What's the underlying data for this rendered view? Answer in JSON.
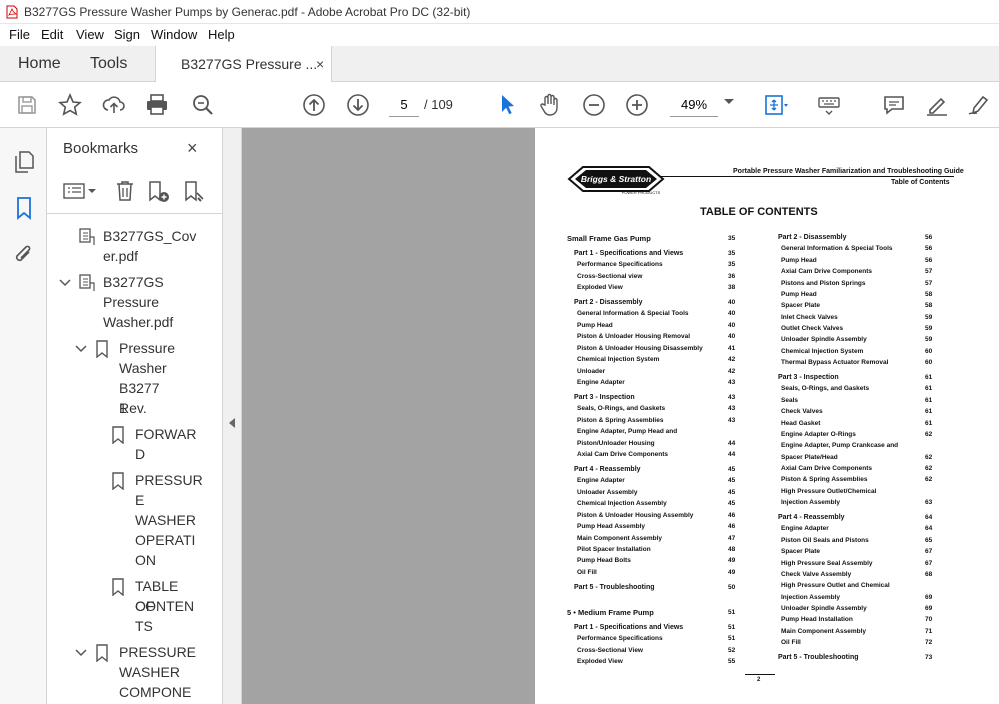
{
  "window": {
    "title": "B3277GS Pressure Washer Pumps by Generac.pdf - Adobe Acrobat Pro DC (32-bit)"
  },
  "menu": [
    "File",
    "Edit",
    "View",
    "Sign",
    "Window",
    "Help"
  ],
  "tabs": {
    "home": "Home",
    "tools": "Tools",
    "doc": "B3277GS Pressure ...",
    "close": "×"
  },
  "toolbar": {
    "page_current": "5",
    "page_total": "/  109",
    "zoom": "49%"
  },
  "bookmarks": {
    "title": "Bookmarks",
    "close": "×",
    "items": [
      {
        "lines": [
          "B3277GS_Cov",
          "er.pdf"
        ]
      },
      {
        "lines": [
          "B3277GS",
          "Pressure",
          "Washer.pdf"
        ]
      },
      {
        "lines": [
          "Pressure",
          "Washer",
          "B3277 Rev.",
          "1"
        ]
      },
      {
        "lines": [
          "FORWAR",
          "D"
        ]
      },
      {
        "lines": [
          "PRESSUR",
          "E",
          "WASHER",
          "OPERATI",
          "ON"
        ]
      },
      {
        "lines": [
          "TABLE OF",
          "CONTEN",
          "TS"
        ]
      },
      {
        "lines": [
          "PRESSURE",
          "WASHER",
          "COMPONE"
        ]
      }
    ]
  },
  "pdf": {
    "logo_text": "Briggs & Stratton",
    "logo_sub": "POWER PRODUCTS",
    "header_right": "Portable Pressure Washer Familiarization and Troubleshooting Guide",
    "header_sub": "Table of Contents",
    "toc_title": "TABLE OF CONTENTS",
    "footer_page": "2",
    "left_col": [
      {
        "t": "Small Frame Gas Pump",
        "p": "35",
        "k": "sec"
      },
      {
        "t": "Part 1 - Specifications and Views",
        "p": "35",
        "k": "part"
      },
      {
        "t": "Performance Specifications",
        "p": "35",
        "k": "item"
      },
      {
        "t": "Cross-Sectional view",
        "p": "36",
        "k": "item"
      },
      {
        "t": "Exploded View",
        "p": "38",
        "k": "item"
      },
      {
        "t": "Part 2 - Disassembly",
        "p": "40",
        "k": "part"
      },
      {
        "t": "General Information & Special Tools",
        "p": "40",
        "k": "item"
      },
      {
        "t": "Pump Head",
        "p": "40",
        "k": "item"
      },
      {
        "t": "Piston & Unloader Housing Removal",
        "p": "40",
        "k": "item"
      },
      {
        "t": "Piston & Unloader Housing Disassembly",
        "p": "41",
        "k": "item"
      },
      {
        "t": "Chemical Injection System",
        "p": "42",
        "k": "item"
      },
      {
        "t": "Unloader",
        "p": "42",
        "k": "item"
      },
      {
        "t": "Engine Adapter",
        "p": "43",
        "k": "item"
      },
      {
        "t": "Part 3 - Inspection",
        "p": "43",
        "k": "part"
      },
      {
        "t": "Seals, O-Rings, and Gaskets",
        "p": "43",
        "k": "item"
      },
      {
        "t": "Piston & Spring Assemblies",
        "p": "43",
        "k": "item"
      },
      {
        "t": "Engine Adapter, Pump Head and",
        "p": "",
        "k": "item"
      },
      {
        "t": "Piston/Unloader Housing",
        "p": "44",
        "k": "item"
      },
      {
        "t": "Axial Cam Drive Components",
        "p": "44",
        "k": "item"
      },
      {
        "t": "Part 4 - Reassembly",
        "p": "45",
        "k": "part"
      },
      {
        "t": "Engine Adapter",
        "p": "45",
        "k": "item"
      },
      {
        "t": "Unloader Assembly",
        "p": "45",
        "k": "item"
      },
      {
        "t": "Chemical Injection Assembly",
        "p": "45",
        "k": "item"
      },
      {
        "t": "Piston & Unloader Housing Assembly",
        "p": "46",
        "k": "item"
      },
      {
        "t": "Pump Head Assembly",
        "p": "46",
        "k": "item"
      },
      {
        "t": "Main Component Assembly",
        "p": "47",
        "k": "item"
      },
      {
        "t": "Pilot Spacer Installation",
        "p": "48",
        "k": "item"
      },
      {
        "t": "Pump Head Bolts",
        "p": "49",
        "k": "item"
      },
      {
        "t": "Oil Fill",
        "p": "49",
        "k": "item"
      },
      {
        "t": "Part 5 - Troubleshooting",
        "p": "50",
        "k": "part"
      },
      {
        "t": "5 • Medium Frame Pump",
        "p": "51",
        "k": "sec"
      },
      {
        "t": "Part 1 - Specifications and Views",
        "p": "51",
        "k": "part"
      },
      {
        "t": "Performance Specifications",
        "p": "51",
        "k": "item"
      },
      {
        "t": "Cross-Sectional View",
        "p": "52",
        "k": "item"
      },
      {
        "t": "Exploded View",
        "p": "55",
        "k": "item"
      }
    ],
    "right_col": [
      {
        "t": "Part 2 - Disassembly",
        "p": "56",
        "k": "part"
      },
      {
        "t": "General Information & Special Tools",
        "p": "56",
        "k": "item"
      },
      {
        "t": "Pump Head",
        "p": "56",
        "k": "item"
      },
      {
        "t": "Axial Cam Drive Components",
        "p": "57",
        "k": "item"
      },
      {
        "t": "Pistons and Piston Springs",
        "p": "57",
        "k": "item"
      },
      {
        "t": "Pump Head",
        "p": "58",
        "k": "item"
      },
      {
        "t": "Spacer Plate",
        "p": "58",
        "k": "item"
      },
      {
        "t": "Inlet Check Valves",
        "p": "59",
        "k": "item"
      },
      {
        "t": "Outlet Check Valves",
        "p": "59",
        "k": "item"
      },
      {
        "t": "Unloader Spindle Assembly",
        "p": "59",
        "k": "item"
      },
      {
        "t": "Chemical Injection System",
        "p": "60",
        "k": "item"
      },
      {
        "t": "Thermal Bypass Actuator Removal",
        "p": "60",
        "k": "item"
      },
      {
        "t": "Part 3 - Inspection",
        "p": "61",
        "k": "part"
      },
      {
        "t": "Seals, O-Rings, and Gaskets",
        "p": "61",
        "k": "item"
      },
      {
        "t": "Seals",
        "p": "61",
        "k": "item"
      },
      {
        "t": "Check Valves",
        "p": "61",
        "k": "item"
      },
      {
        "t": "Head Gasket",
        "p": "61",
        "k": "item"
      },
      {
        "t": "Engine Adapter O-Rings",
        "p": "62",
        "k": "item"
      },
      {
        "t": "Engine Adapter, Pump Crankcase and",
        "p": "",
        "k": "item"
      },
      {
        "t": "Spacer Plate/Head",
        "p": "62",
        "k": "item"
      },
      {
        "t": "Axial Cam Drive Components",
        "p": "62",
        "k": "item"
      },
      {
        "t": "Piston & Spring Assemblies",
        "p": "62",
        "k": "item"
      },
      {
        "t": "High Pressure Outlet/Chemical",
        "p": "",
        "k": "item"
      },
      {
        "t": "Injection Assembly",
        "p": "63",
        "k": "item"
      },
      {
        "t": "Part 4 - Reassembly",
        "p": "64",
        "k": "part"
      },
      {
        "t": "Engine Adapter",
        "p": "64",
        "k": "item"
      },
      {
        "t": "Piston Oil Seals and Pistons",
        "p": "65",
        "k": "item"
      },
      {
        "t": "Spacer Plate",
        "p": "67",
        "k": "item"
      },
      {
        "t": "High Pressure Seal Assembly",
        "p": "67",
        "k": "item"
      },
      {
        "t": "Check Valve Assembly",
        "p": "68",
        "k": "item"
      },
      {
        "t": "High Pressure Outlet and Chemical",
        "p": "",
        "k": "item"
      },
      {
        "t": "Injection Assembly",
        "p": "69",
        "k": "item"
      },
      {
        "t": "Unloader Spindle Assembly",
        "p": "69",
        "k": "item"
      },
      {
        "t": "Pump Head Installation",
        "p": "70",
        "k": "item"
      },
      {
        "t": "Main Component Assembly",
        "p": "71",
        "k": "item"
      },
      {
        "t": "Oil Fill",
        "p": "72",
        "k": "item"
      },
      {
        "t": "Part 5 - Troubleshooting",
        "p": "73",
        "k": "part"
      }
    ]
  }
}
